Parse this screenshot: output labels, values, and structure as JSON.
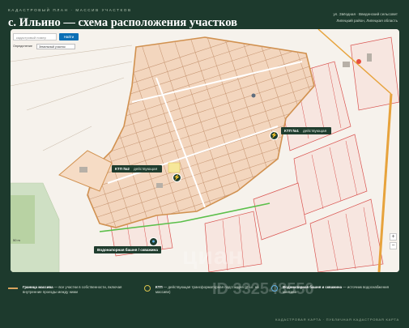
{
  "header": {
    "kicker": "Кадастровый план · Массив участков",
    "title": "с. Ильино — схема расположения участков",
    "address_line1": "ул. Звёздная · Введенский сельсовет",
    "address_line2": "Липецкий район, Липецкая область"
  },
  "map": {
    "search": {
      "placeholder": "кадастровый номер",
      "button": "Найти"
    },
    "filter": {
      "label": "Определение",
      "value": "Земельный участок"
    },
    "zoom": {
      "in": "+",
      "out": "−"
    },
    "scale_label": "50 m",
    "callouts": [
      {
        "title": "КТП №1",
        "status": "действующая"
      },
      {
        "title": "КТП №2",
        "status": "действующая"
      },
      {
        "title": "Водонапорная башня / скважина",
        "status": ""
      }
    ],
    "colors": {
      "parcel_fill": "#f3d6be",
      "parcel_line": "#c79673",
      "boundary": "#d1914f",
      "red_lines": "#d9534f",
      "road": "#e7a33c",
      "green": "#5bbf4a"
    }
  },
  "legend": [
    {
      "title": "Граница массива",
      "text": "— все участки в собственности, включая внутренние проезды между ними"
    },
    {
      "title": "КТП",
      "text": "— действующая трансформаторная подстанция (2 шт. на массиве)"
    },
    {
      "title": "Водонапорная башня и скважина",
      "text": "— источник водоснабжения массива"
    }
  ],
  "footer": "Кадастровая карта · Публичная кадастровая карта",
  "watermark": {
    "brand": "циан",
    "id": "ID 332548550"
  }
}
